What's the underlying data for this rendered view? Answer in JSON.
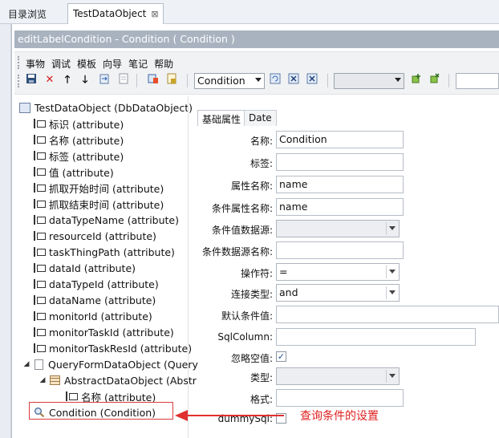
{
  "tabs": [
    {
      "label": "目录浏览"
    },
    {
      "label": "TestDataObject"
    }
  ],
  "editor_title": "editLabelCondition - Condition ( Condition )",
  "menu": [
    "事物",
    "调试",
    "模板",
    "向导",
    "笔记",
    "帮助"
  ],
  "toolbar": {
    "select1_value": "Condition",
    "select2_value": ""
  },
  "tree": {
    "root": "TestDataObject (DbDataObject)",
    "attributes": [
      "标识 (attribute)",
      "名称 (attribute)",
      "标签 (attribute)",
      "值 (attribute)",
      "抓取开始时间 (attribute)",
      "抓取结束时间 (attribute)",
      "dataTypeName (attribute)",
      "resourceId (attribute)",
      "taskThingPath (attribute)",
      "dataId (attribute)",
      "dataTypeId (attribute)",
      "dataName (attribute)",
      "monitorId (attribute)",
      "monitorTaskId (attribute)",
      "monitorTaskResId (attribute)"
    ],
    "query_node": "QueryFormDataObject (Query",
    "abstract_node": "AbstractDataObject (Abstr",
    "nested_attr": "名称 (attribute)",
    "condition_node": "Condition (Condition)"
  },
  "props": {
    "tab_basic": "基础属性",
    "tab_date": "Date",
    "labels": {
      "name": "名称:",
      "label": "标签:",
      "attr_name": "属性名称:",
      "cond_attr_name": "条件属性名称:",
      "cond_value_source": "条件值数据源:",
      "cond_source_name": "条件数据源名称:",
      "operator": "操作符:",
      "join_type": "连接类型:",
      "default_value": "默认条件值:",
      "sql_column": "SqlColumn:",
      "ignore_null": "忽略空值:",
      "type": "类型:",
      "format": "格式:",
      "dummy_sql": "dummySql:"
    },
    "values": {
      "name": "Condition",
      "label": "",
      "attr_name": "name",
      "cond_attr_name": "name",
      "cond_value_source": "",
      "cond_source_name": "",
      "operator": "=",
      "join_type": "and",
      "default_value": "",
      "sql_column": "",
      "type": "",
      "format": ""
    },
    "ignore_null_checked": true,
    "dummy_sql_checked": false
  },
  "annotation": "查询条件的设置",
  "colors": {
    "title_bar": "#a9b3c0",
    "annotation": "#e03030"
  }
}
